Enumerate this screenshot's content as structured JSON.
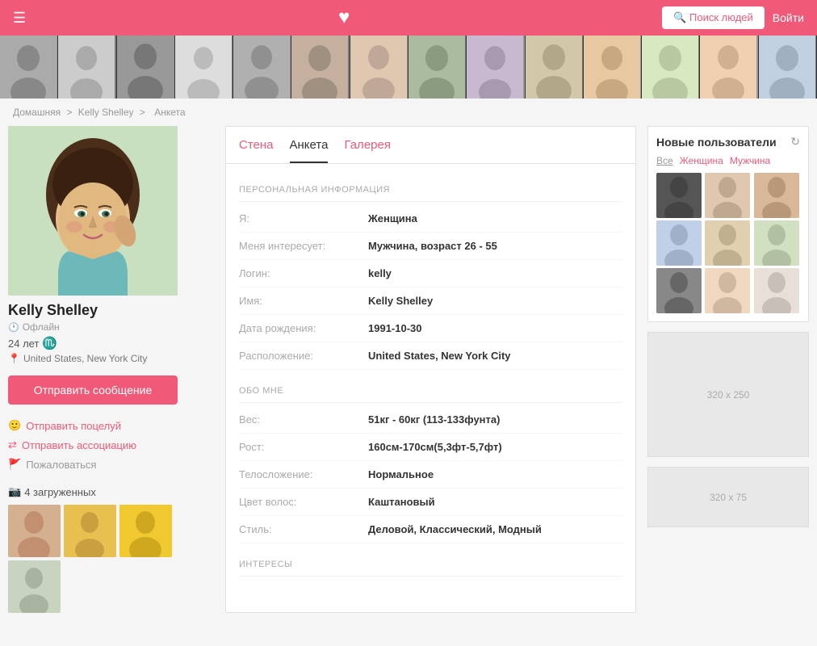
{
  "header": {
    "search_label": "🔍 Поиск людей",
    "login_label": "Войти",
    "heart": "♥"
  },
  "breadcrumb": {
    "home": "Домашняя",
    "separator": ">",
    "name": "Kelly Shelley",
    "page": "Анкета"
  },
  "tabs": [
    {
      "label": "Стена",
      "active": false
    },
    {
      "label": "Анкета",
      "active": true
    },
    {
      "label": "Галерея",
      "active": false
    }
  ],
  "profile": {
    "name": "Kelly Shelley",
    "status": "Офлайн",
    "age": "24 лет",
    "sign": "♏",
    "location": "United States, New York City",
    "send_message": "Отправить сообщение",
    "actions": {
      "kiss": "Отправить поцелуй",
      "association": "Отправить ассоциацию",
      "complaint": "Пожаловаться"
    },
    "photos_count": "4 загруженных"
  },
  "sections": {
    "personal": {
      "title": "ПЕРСОНАЛЬНАЯ ИНФОРМАЦИЯ",
      "rows": [
        {
          "label": "Я:",
          "value": "Женщина"
        },
        {
          "label": "Меня интересует:",
          "value": "Мужчина, возраст 26 - 55"
        },
        {
          "label": "Логин:",
          "value": "kelly"
        },
        {
          "label": "Имя:",
          "value": "Kelly Shelley"
        },
        {
          "label": "Дата рождения:",
          "value": "1991-10-30"
        },
        {
          "label": "Расположение:",
          "value": "United States, New York City"
        }
      ]
    },
    "about": {
      "title": "ОБО МНЕ",
      "rows": [
        {
          "label": "Вес:",
          "value": "51кг - 60кг (113-133фунта)"
        },
        {
          "label": "Рост:",
          "value": "160см-170см(5,3фт-5,7фт)"
        },
        {
          "label": "Телосложение:",
          "value": "Нормальное"
        },
        {
          "label": "Цвет волос:",
          "value": "Каштановый"
        },
        {
          "label": "Стиль:",
          "value": "Деловой, Классический, Модный"
        }
      ]
    },
    "interests": {
      "title": "ИНТЕРЕСЫ"
    }
  },
  "new_users": {
    "title": "Новые пользователи",
    "filters": [
      "Все",
      "Женщина",
      "Мужчина"
    ]
  },
  "ads": {
    "large": "320 x 250",
    "small": "320 x 75"
  }
}
